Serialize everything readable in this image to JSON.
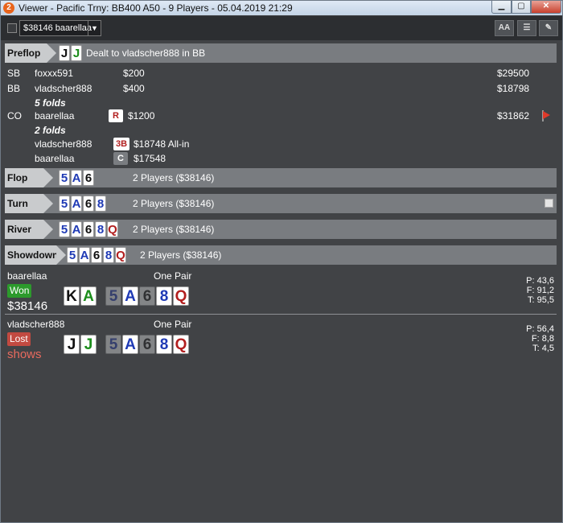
{
  "window": {
    "title": "Viewer - Pacific Trny: BB400 A50 - 9 Players - 05.04.2019 21:29",
    "icon_label": "2"
  },
  "toolbar": {
    "hand_select": "$38146 baarellaa",
    "btn_font": "AA",
    "btn_list": "☰",
    "btn_edit": "✎"
  },
  "preflop": {
    "label": "Preflop",
    "hole_cards": [
      {
        "rank": "J",
        "color": "#111111"
      },
      {
        "rank": "J",
        "color": "#1b8d1b"
      }
    ],
    "dealt_text": "Dealt to vladscher888 in BB",
    "blinds": [
      {
        "pos": "SB",
        "name": "foxxx591",
        "amount": "$200",
        "stack": "$29500"
      },
      {
        "pos": "BB",
        "name": "vladscher888",
        "amount": "$400",
        "stack": "$18798"
      }
    ],
    "folds1": "5 folds",
    "raise": {
      "pos": "CO",
      "name": "baarellaa",
      "action": "R",
      "amount": "$1200",
      "stack": "$31862"
    },
    "folds2": "2 folds",
    "threebet": {
      "name": "vladscher888",
      "action": "3B",
      "amount": "$18748 All-in"
    },
    "call": {
      "name": "baarellaa",
      "action": "C",
      "amount": "$17548"
    }
  },
  "flop": {
    "label": "Flop",
    "cards": [
      {
        "rank": "5",
        "color": "#1f3ab5"
      },
      {
        "rank": "A",
        "color": "#1f3ab5"
      },
      {
        "rank": "6",
        "color": "#111111"
      }
    ],
    "text": "2 Players ($38146)"
  },
  "turn": {
    "label": "Turn",
    "cards": [
      {
        "rank": "5",
        "color": "#1f3ab5"
      },
      {
        "rank": "A",
        "color": "#1f3ab5"
      },
      {
        "rank": "6",
        "color": "#111111"
      },
      {
        "rank": "8",
        "color": "#1f3ab5"
      }
    ],
    "text": "2 Players ($38146)"
  },
  "river": {
    "label": "River",
    "cards": [
      {
        "rank": "5",
        "color": "#1f3ab5"
      },
      {
        "rank": "A",
        "color": "#1f3ab5"
      },
      {
        "rank": "6",
        "color": "#111111"
      },
      {
        "rank": "8",
        "color": "#1f3ab5"
      },
      {
        "rank": "Q",
        "color": "#b21f1f"
      }
    ],
    "text": "2 Players ($38146)"
  },
  "showdown": {
    "label": "Showdown",
    "cards": [
      {
        "rank": "5",
        "color": "#1f3ab5"
      },
      {
        "rank": "A",
        "color": "#1f3ab5"
      },
      {
        "rank": "6",
        "color": "#111111"
      },
      {
        "rank": "8",
        "color": "#1f3ab5"
      },
      {
        "rank": "Q",
        "color": "#b21f1f"
      }
    ],
    "text": "2 Players ($38146)",
    "players": [
      {
        "name": "baarellaa",
        "hand": "One Pair",
        "result": "Won",
        "amount": "$38146",
        "hole": [
          {
            "rank": "K",
            "color": "#111111"
          },
          {
            "rank": "A",
            "color": "#1b8d1b"
          }
        ],
        "board": [
          {
            "rank": "5",
            "color": "#1f3ab5",
            "dim": true
          },
          {
            "rank": "A",
            "color": "#1f3ab5",
            "dim": false
          },
          {
            "rank": "6",
            "color": "#111111",
            "dim": true
          },
          {
            "rank": "8",
            "color": "#1f3ab5",
            "dim": false
          },
          {
            "rank": "Q",
            "color": "#b21f1f",
            "dim": false
          }
        ],
        "stats": {
          "p": "P: 43,6",
          "f": "F: 91,2",
          "t": "T: 95,5"
        }
      },
      {
        "name": "vladscher888",
        "hand": "One Pair",
        "result": "Lost",
        "amount": "shows",
        "hole": [
          {
            "rank": "J",
            "color": "#111111"
          },
          {
            "rank": "J",
            "color": "#1b8d1b"
          }
        ],
        "board": [
          {
            "rank": "5",
            "color": "#1f3ab5",
            "dim": true
          },
          {
            "rank": "A",
            "color": "#1f3ab5",
            "dim": false
          },
          {
            "rank": "6",
            "color": "#111111",
            "dim": true
          },
          {
            "rank": "8",
            "color": "#1f3ab5",
            "dim": false
          },
          {
            "rank": "Q",
            "color": "#b21f1f",
            "dim": false
          }
        ],
        "stats": {
          "p": "P: 56,4",
          "f": "F:   8,8",
          "t": "T:   4,5"
        }
      }
    ]
  }
}
